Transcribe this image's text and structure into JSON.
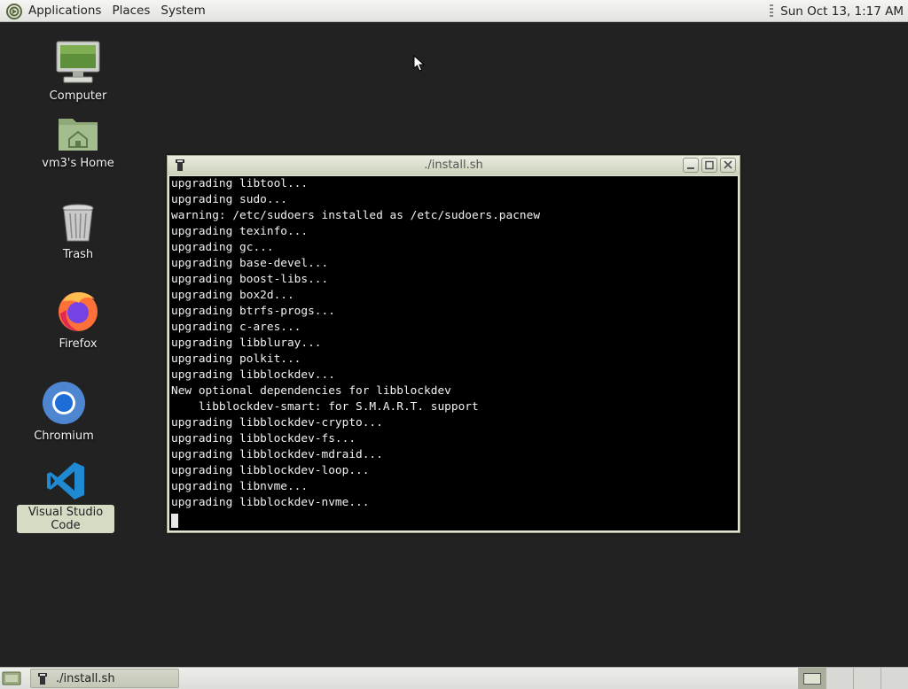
{
  "top_panel": {
    "menus": [
      "Applications",
      "Places",
      "System"
    ],
    "clock": "Sun Oct 13, 1:17 AM"
  },
  "desktop": {
    "icons": [
      {
        "label": "Computer",
        "icon": "computer-icon"
      },
      {
        "label": "vm3's Home",
        "icon": "home-folder-icon"
      },
      {
        "label": "Trash",
        "icon": "trash-icon"
      },
      {
        "label": "Firefox",
        "icon": "firefox-icon"
      },
      {
        "label": "Chromium",
        "icon": "chromium-icon"
      },
      {
        "label": "Visual Studio Code",
        "icon": "vscode-icon",
        "selected": true
      }
    ]
  },
  "window": {
    "title": "./install.sh",
    "terminal_lines": [
      "upgrading libtool...",
      "upgrading sudo...",
      "warning: /etc/sudoers installed as /etc/sudoers.pacnew",
      "upgrading texinfo...",
      "upgrading gc...",
      "upgrading base-devel...",
      "upgrading boost-libs...",
      "upgrading box2d...",
      "upgrading btrfs-progs...",
      "upgrading c-ares...",
      "upgrading libbluray...",
      "upgrading polkit...",
      "upgrading libblockdev...",
      "New optional dependencies for libblockdev",
      "    libblockdev-smart: for S.M.A.R.T. support",
      "upgrading libblockdev-crypto...",
      "upgrading libblockdev-fs...",
      "upgrading libblockdev-mdraid...",
      "upgrading libblockdev-loop...",
      "upgrading libnvme...",
      "upgrading libblockdev-nvme..."
    ]
  },
  "bottom_panel": {
    "task_label": "./install.sh",
    "workspaces": 4,
    "active_workspace": 1
  },
  "colors": {
    "desktop_bg": "#222222",
    "panel_bg": "#ebebe8",
    "titlebar": "#dfe3d3",
    "terminal_bg": "#000000",
    "terminal_fg": "#f2f2f2"
  }
}
